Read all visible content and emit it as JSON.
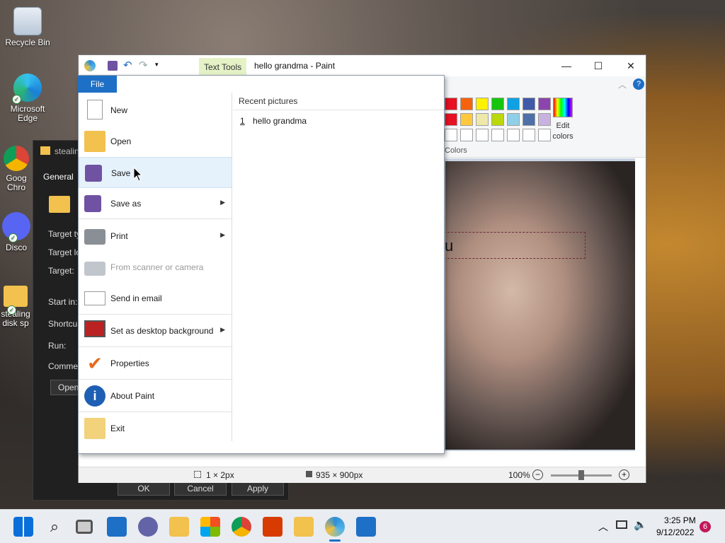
{
  "desktop": {
    "recycle_bin": "Recycle Bin",
    "edge": "Microsoft Edge",
    "chrome": "Goog Chro",
    "discord": "Disco",
    "folder": "stealing disk sp"
  },
  "props": {
    "title": "stealin",
    "tab": "General",
    "target_type": "Target ty",
    "target_location": "Target lo",
    "target": "Target:",
    "start_in": "Start in:",
    "shortcut": "Shortcu",
    "run": "Run:",
    "comment": "Commer",
    "open": "Open",
    "ok": "OK",
    "cancel": "Cancel",
    "apply": "Apply"
  },
  "paint": {
    "title": "hello grandma - Paint",
    "context_tab": "Text Tools",
    "file_tab": "File",
    "edit_colors": "Edit colors",
    "colors_label": "Colors",
    "canvas_text": "u",
    "status": {
      "selection": "1 × 2px",
      "size": "935 × 900px",
      "zoom": "100%"
    },
    "palette_row1": [
      "#e81123",
      "#f7630c",
      "#fff100",
      "#16c60c",
      "#0fa1e4",
      "#4059a9",
      "#8e44ad"
    ],
    "palette_row2": [
      "#e81123",
      "#ffc83d",
      "#eee8aa",
      "#bad80a",
      "#8fd0e8",
      "#4e6fa8",
      "#c8b3e0"
    ]
  },
  "file_menu": {
    "items": [
      {
        "label": "New",
        "icon": "new-file-icon",
        "arrow": false,
        "disabled": false
      },
      {
        "label": "Open",
        "icon": "open-folder-icon",
        "arrow": false,
        "disabled": false
      },
      {
        "label": "Save",
        "icon": "floppy-disk-icon",
        "arrow": false,
        "disabled": false
      },
      {
        "label": "Save as",
        "icon": "save-as-icon",
        "arrow": true,
        "disabled": false
      },
      {
        "label": "Print",
        "icon": "printer-icon",
        "arrow": true,
        "disabled": false
      },
      {
        "label": "From scanner or camera",
        "icon": "scanner-icon",
        "arrow": false,
        "disabled": true
      },
      {
        "label": "Send in email",
        "icon": "email-icon",
        "arrow": false,
        "disabled": false
      },
      {
        "label": "Set as desktop background",
        "icon": "desktop-background-icon",
        "arrow": true,
        "disabled": false
      },
      {
        "label": "Properties",
        "icon": "checkmark-icon",
        "arrow": false,
        "disabled": false
      },
      {
        "label": "About Paint",
        "icon": "info-icon",
        "arrow": false,
        "disabled": false
      },
      {
        "label": "Exit",
        "icon": "exit-icon",
        "arrow": false,
        "disabled": false
      }
    ],
    "recent_header": "Recent pictures",
    "recent": [
      {
        "num": "1",
        "name": "hello grandma"
      }
    ]
  },
  "taskbar": {
    "time": "3:25 PM",
    "date": "9/12/2022",
    "badge": "6"
  }
}
